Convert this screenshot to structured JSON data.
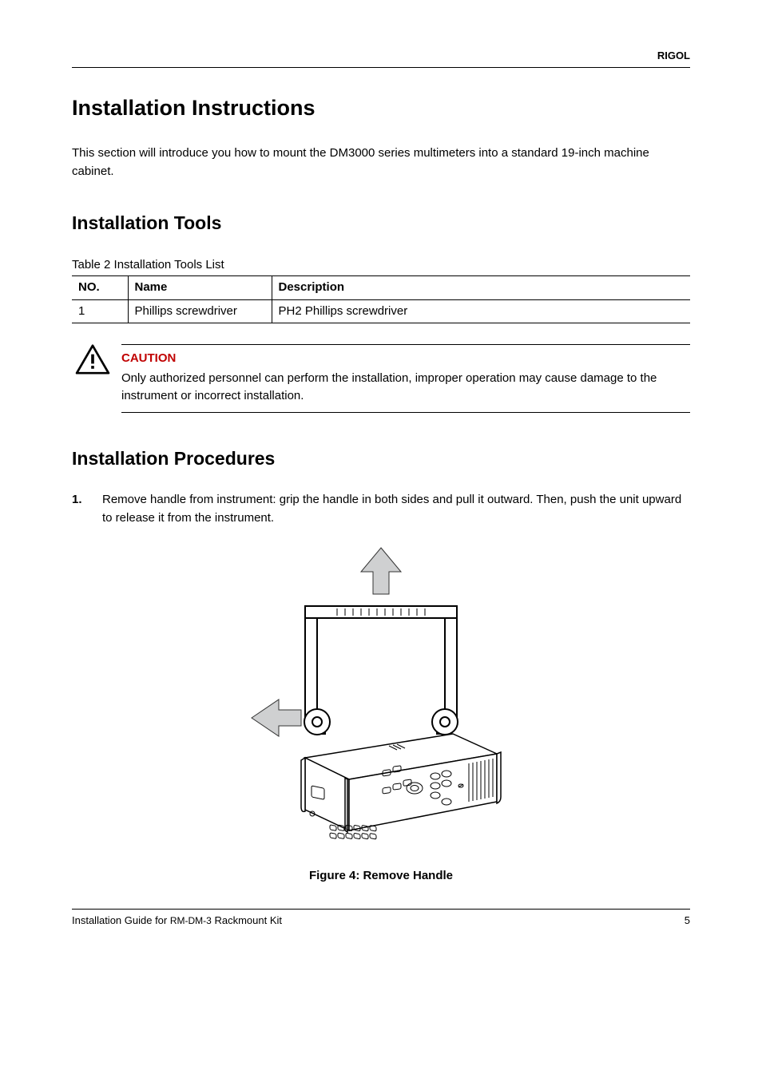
{
  "brand": "RIGOL",
  "headings": {
    "h1": "Installation Instructions",
    "h2_tools": "Installation Tools",
    "h2_proc": "Installation Procedures"
  },
  "intro": "This section will introduce you how to mount the DM3000 series multimeters into a standard 19-inch machine cabinet.",
  "table": {
    "caption": "Table 2 Installation Tools List",
    "headers": {
      "no": "NO.",
      "name": "Name",
      "desc": "Description"
    },
    "rows": [
      {
        "no": "1",
        "name": "Phillips screwdriver",
        "desc": "PH2 Phillips screwdriver"
      }
    ]
  },
  "caution": {
    "label": "CAUTION",
    "text": "Only authorized personnel can perform the installation, improper operation may cause damage to the instrument or incorrect installation."
  },
  "procedure": {
    "step1_num": "1.",
    "step1_text": "Remove handle from instrument: grip the handle in both sides and pull it outward. Then, push the unit upward to release it from the instrument."
  },
  "figure": {
    "caption": "Figure 4: Remove Handle"
  },
  "footer": {
    "left_prefix": "Installation Guide for ",
    "left_mid": "RM-DM-3",
    "left_suffix": " Rackmount Kit",
    "page": "5"
  }
}
